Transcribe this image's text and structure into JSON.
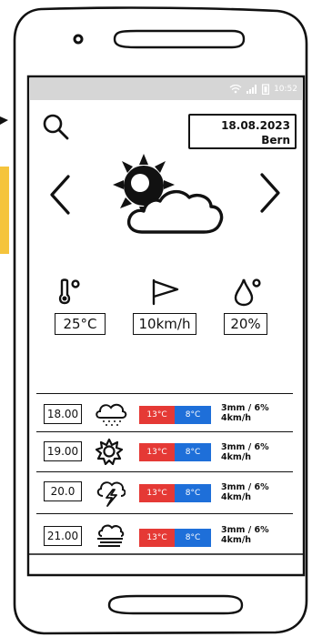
{
  "status_bar": {
    "time": "10:52"
  },
  "header": {
    "date": "18.08.2023",
    "city": "Bern"
  },
  "current": {
    "weather_icon": "partly-cloudy-sun-icon",
    "temperature": "25°C",
    "wind": "10km/h",
    "humidity": "20%"
  },
  "hourly": [
    {
      "hour": "18.00",
      "icon": "rain-cloud-icon",
      "high": "13°C",
      "low": "8°C",
      "precip": "3mm / 6%",
      "wind": "4km/h"
    },
    {
      "hour": "19.00",
      "icon": "sun-icon",
      "high": "13°C",
      "low": "8°C",
      "precip": "3mm / 6%",
      "wind": "4km/h"
    },
    {
      "hour": "20.0",
      "icon": "thunderstorm-icon",
      "high": "13°C",
      "low": "8°C",
      "precip": "3mm / 6%",
      "wind": "4km/h"
    },
    {
      "hour": "21.00",
      "icon": "fog-icon",
      "high": "13°C",
      "low": "8°C",
      "precip": "3mm / 6%",
      "wind": "4km/h"
    }
  ],
  "colors": {
    "high_temp": "#e53935",
    "low_temp": "#1e6fd9",
    "status_bar": "#d6d6d6"
  }
}
